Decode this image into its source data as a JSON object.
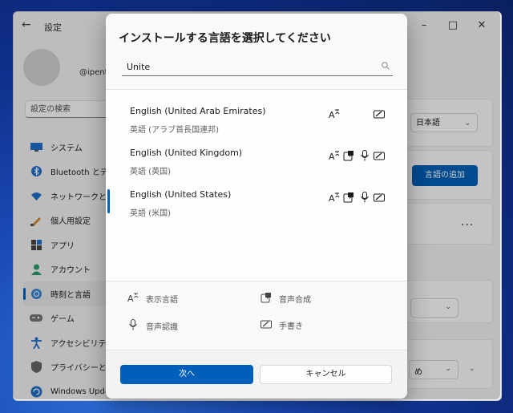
{
  "settings": {
    "app_title": "設定",
    "user_name": "@ipente",
    "search_placeholder": "設定の検索",
    "nav": [
      {
        "label": "システム",
        "icon": "monitor-icon"
      },
      {
        "label": "Bluetooth とデバ",
        "icon": "bluetooth-icon"
      },
      {
        "label": "ネットワークとイン",
        "icon": "wifi-icon"
      },
      {
        "label": "個人用設定",
        "icon": "brush-icon"
      },
      {
        "label": "アプリ",
        "icon": "apps-icon"
      },
      {
        "label": "アカウント",
        "icon": "person-icon"
      },
      {
        "label": "時刻と言語",
        "icon": "globe-clock-icon"
      },
      {
        "label": "ゲーム",
        "icon": "gamepad-icon"
      },
      {
        "label": "アクセシビリティ",
        "icon": "accessibility-icon"
      },
      {
        "label": "プライバシーとセキ",
        "icon": "shield-icon"
      },
      {
        "label": "Windows Upda",
        "icon": "update-icon"
      }
    ],
    "active_nav": "時刻と言語",
    "display_language_value": "日本語",
    "add_language_label": "言語の追加",
    "region_dropdown_value": "め"
  },
  "dialog": {
    "title": "インストールする言語を選択してください",
    "search_value": "Unite",
    "languages": [
      {
        "name": "English (United Arab Emirates)",
        "native": "英語 (アラブ首長国連邦)",
        "features": [
          "display-language",
          "handwriting"
        ]
      },
      {
        "name": "English (United Kingdom)",
        "native": "英語 (英国)",
        "features": [
          "display-language",
          "text-to-speech",
          "speech-recognition",
          "handwriting"
        ]
      },
      {
        "name": "English (United States)",
        "native": "英語 (米国)",
        "features": [
          "display-language",
          "text-to-speech",
          "speech-recognition",
          "handwriting"
        ]
      }
    ],
    "legend": {
      "display_language": "表示言語",
      "text_to_speech": "音声合成",
      "speech_recognition": "音声認識",
      "handwriting": "手書き"
    },
    "next_label": "次へ",
    "cancel_label": "キャンセル"
  },
  "colors": {
    "accent": "#005fb8"
  }
}
